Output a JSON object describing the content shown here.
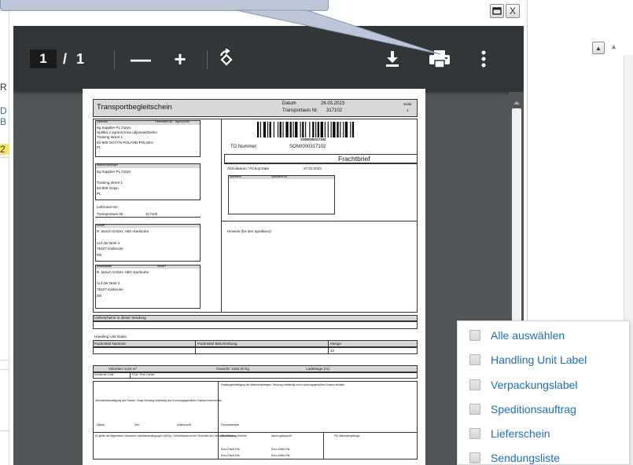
{
  "background_app": {
    "fragments": [
      "R",
      "D",
      "B",
      "2"
    ]
  },
  "viewer": {
    "page_current": "1",
    "page_separator": "/",
    "page_total": "1",
    "zoom_out_label": "—",
    "zoom_in_label": "+",
    "icons": [
      "rotate-icon",
      "download-icon",
      "print-icon",
      "more-vert-icon"
    ]
  },
  "window_controls": {
    "restore_icon": "restore-icon",
    "close_label": "X"
  },
  "document": {
    "title": "Transportbegleitschein",
    "datum_label": "Datum",
    "datum_value": "26.03.2023",
    "transportavis_label": "Transportavis Nr.",
    "transportavis_value": "317102",
    "seite_label": "Seite",
    "seite_value": "1",
    "lieferant_label": "Lieferant",
    "lieferanten_nr_label": "Lieferanten-Nr.",
    "lieferanten_nr_value": "Itg9000096",
    "lieferant_lines": [
      "Itg Supplier PL Gotyn",
      "Spółka z ograniczona odpowiedzialno",
      "Training street 1",
      "63-800 GOTYN POLAND-POLSKA",
      "PL"
    ],
    "versand_label": "Warenempfänger",
    "versand_lines": [
      "Itg Supplier PL Gotyn",
      "",
      "Training street 1",
      "63-800 Gotyn",
      "PL"
    ],
    "lieferavis_label": "Lieferavis-Nr.:",
    "transportavis2_label": "Transportavis Nr.",
    "transportavis2_value": "317102",
    "kunde_label": "Kunde",
    "kunde_lines": [
      "R. Bosch GmbH, ABC-Karlsruhe",
      "",
      "Auf der Breit 4",
      "76227 Karlsruhe",
      "DE"
    ],
    "abladestelle_label": "Abladestelle",
    "abladestelle_code": "9K05H",
    "abladestelle_lines": [
      "R. Bosch GmbH, ABC-Karlsruhe",
      "",
      "Auf der Breit 4",
      "76227 Karlsruhe",
      "DE"
    ],
    "barcode_text": "SON0000317102",
    "to_nummer_label": "TO Nummer:",
    "to_nummer_value": "SON0000317102",
    "frachtbrief_label": "Frachtbrief",
    "abholdatum_label": "Abholdatum / Pickup Date",
    "abholdatum_value": "27.03.2023",
    "spediteur_label": "Spediteur",
    "spediteur_nr_label": "Spediteur-Nr.",
    "hinweis_label": "Hinweis (für den Spediteur):",
    "lieferscheine_label": "Lieferscheine in dieser Sendung",
    "hu_daten_label": "Handling Unit Daten",
    "hu_headers": [
      "Packmittel Nummer",
      "Packmittel Beschreibung",
      "Menge"
    ],
    "hu_menge_value": "10",
    "volumen_label": "Volumen: 6,64 m³",
    "gewicht_label": "Gewicht: 1250,00 kg",
    "ladelaenge_label": "Ladelänge (m):",
    "incoterms_label": "Incoterms Code",
    "incoterms_value": "FCA - Free Carrier",
    "empfang_text": "Empfangsbestätigung des Warenempfängers: Sendung vollständig und in ordnungsgemäßem Zustand erhalten",
    "uebernahme_text": "Übernahmebestätigung des Fahrers: Obige Sendung vollständig und in ordnungsgemäßem Zustand übernommen",
    "datum2_label": "Datum",
    "zeit_label": "Zeit",
    "unterschrift_label": "Unterschrift",
    "firmenstempel_label": "Firmenstempel",
    "agb_text": "Es gelten die Allgemeinen Deutschen Spediteurbedingungen (ADSp) / Gerichtsstand ist der Firmensitz des Versandspediteurs",
    "sendung_enthielt_label": "Die Sendung enthielt",
    "davon_getauscht_label": "davon getauscht",
    "fuer_warenempfaenger_label": "Für Warenempfänger",
    "euro_flach_1": "Euro-Flach-Pal.",
    "euro_gitter_1": "Euro-Gitter-Pal.",
    "euro_flach_2": "Euro-Flach-Pal.",
    "euro_gitter_2": "Euro-Gitter-Pal."
  },
  "dropdown": {
    "items": [
      {
        "label": "Alle auswählen"
      },
      {
        "label": "Handling Unit Label"
      },
      {
        "label": "Verpackungslabel"
      },
      {
        "label": "Speditionsauftrag"
      },
      {
        "label": "Lieferschein"
      },
      {
        "label": "Sendungsliste"
      }
    ]
  },
  "colors": {
    "toolbar_bg": "#323639",
    "viewer_bg": "#525659",
    "link_blue": "#1f6fb8",
    "callout": "#bcc6d6"
  }
}
